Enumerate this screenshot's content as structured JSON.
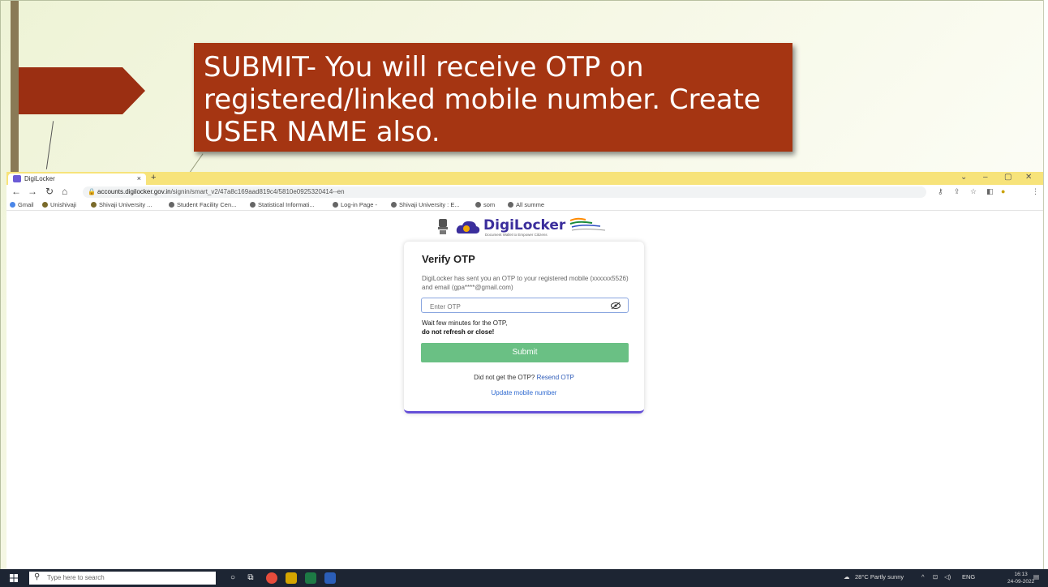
{
  "slide": {
    "callout_text": "SUBMIT- You will receive OTP on registered/linked mobile number. Create USER NAME also."
  },
  "browser": {
    "tab_title": "DigiLocker",
    "tab_close": "×",
    "new_tab": "+",
    "url_host": "accounts.digilocker.gov.in",
    "url_path": "/signin/smart_v2/47a8c169aad819c4/5810e0925320414--en",
    "bookmarks": [
      "Gmail",
      "Unishivaji",
      "Shivaji University ...",
      "Student Facility Cen...",
      "Statistical Informati...",
      "Log-in Page -",
      "Shivaji University : E...",
      "som",
      "All summe"
    ]
  },
  "page": {
    "brand_name": "DigiLocker",
    "brand_tagline": "Document Wallet to Empower Citizens",
    "card": {
      "title": "Verify OTP",
      "message": "DigiLocker has sent you an OTP to your registered mobile (xxxxxx5526) and email (gpa****@gmail.com)",
      "otp_placeholder": "Enter OTP",
      "wait_text": "Wait few minutes for the OTP,",
      "warning_text": "do not refresh or close!",
      "submit_label": "Submit",
      "resend_prompt": "Did not get the OTP?",
      "resend_link": "Resend OTP",
      "update_link": "Update mobile number"
    }
  },
  "taskbar": {
    "search_placeholder": "Type here to search",
    "weather": "28°C Partly sunny",
    "lang": "ENG",
    "time": "16:13",
    "date": "24-09-2022"
  }
}
